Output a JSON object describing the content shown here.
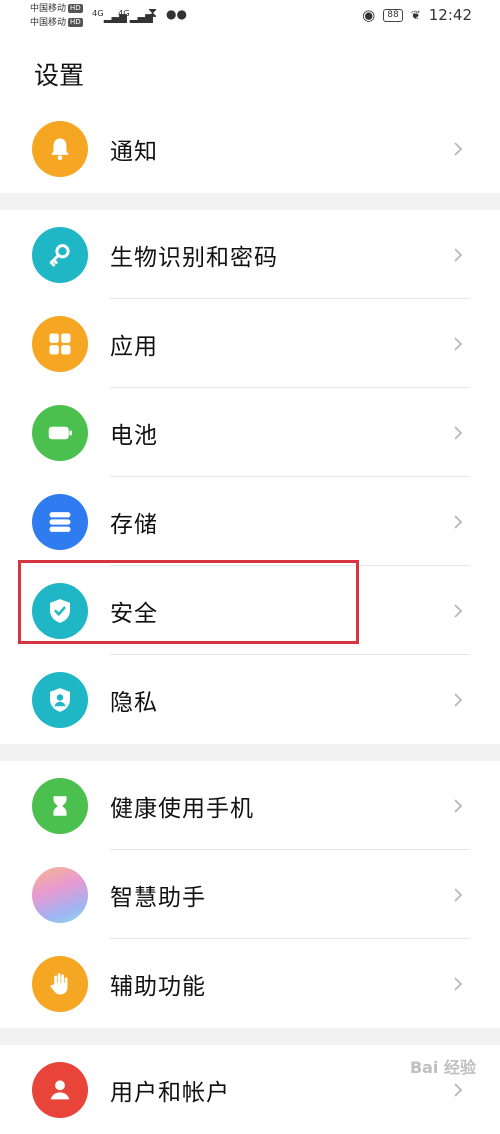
{
  "status_bar": {
    "carrier1": "中国移动",
    "carrier2": "中国移动",
    "hd_badge": "HD",
    "network1": "4G",
    "network2": "4G",
    "battery": "88",
    "time": "12:42"
  },
  "page": {
    "title": "设置"
  },
  "groups": [
    {
      "items": [
        {
          "label": "通知",
          "icon": "bell-icon",
          "color": "#f5a623"
        }
      ]
    },
    {
      "items": [
        {
          "label": "生物识别和密码",
          "icon": "key-icon",
          "color": "#1fb6c6"
        },
        {
          "label": "应用",
          "icon": "apps-grid-icon",
          "color": "#f5a623"
        },
        {
          "label": "电池",
          "icon": "battery-icon",
          "color": "#4cc04e"
        },
        {
          "label": "存储",
          "icon": "storage-icon",
          "color": "#2f7bf0"
        },
        {
          "label": "安全",
          "icon": "shield-check-icon",
          "color": "#1fb6c6"
        },
        {
          "label": "隐私",
          "icon": "privacy-shield-icon",
          "color": "#1fb6c6"
        }
      ]
    },
    {
      "items": [
        {
          "label": "健康使用手机",
          "icon": "hourglass-icon",
          "color": "#4cc04e"
        },
        {
          "label": "智慧助手",
          "icon": "assistant-orb-icon",
          "color": "#c9a8e8"
        },
        {
          "label": "辅助功能",
          "icon": "hand-icon",
          "color": "#f5a623"
        }
      ]
    },
    {
      "items": [
        {
          "label": "用户和帐户",
          "icon": "user-icon",
          "color": "#e8443a"
        }
      ]
    }
  ],
  "highlight_color": "#d6353f",
  "watermark": "Bai 经验"
}
